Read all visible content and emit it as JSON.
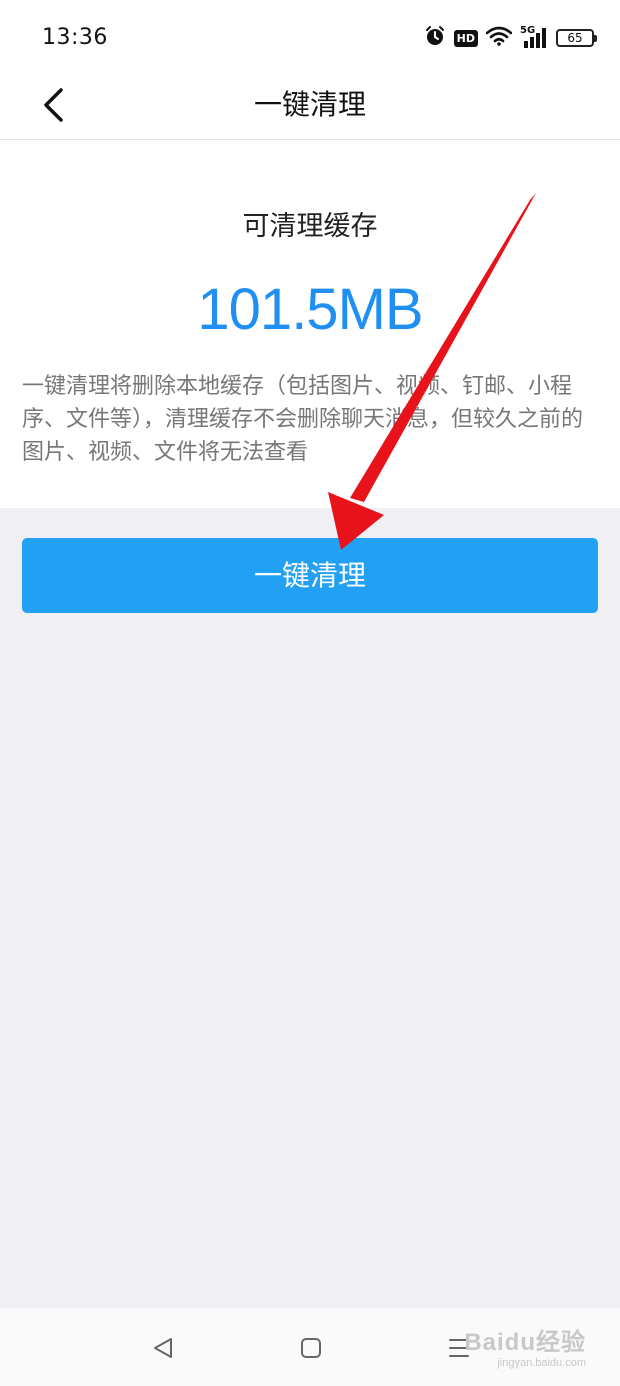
{
  "status_bar": {
    "time": "13:36",
    "hd_label": "HD",
    "network_label": "5G",
    "battery_level": "65",
    "icons": [
      "alarm-icon",
      "hd-icon",
      "wifi-icon",
      "signal-5g-icon",
      "battery-icon"
    ]
  },
  "nav": {
    "title": "一键清理",
    "back_icon": "chevron-left-icon"
  },
  "cache": {
    "label": "可清理缓存",
    "size": "101.5MB",
    "description": "一键清理将删除本地缓存（包括图片、视频、钉邮、小程序、文件等），清理缓存不会删除聊天消息，但较久之前的图片、视频、文件将无法查看"
  },
  "actions": {
    "clean_label": "一键清理"
  },
  "system_nav": {
    "back_icon": "triangle-back-icon",
    "home_icon": "square-home-icon",
    "menu_icon": "menu-lines-icon"
  },
  "watermark": {
    "main": "Baidu经验",
    "sub": "jingyan.baidu.com"
  },
  "colors": {
    "accent": "#22a0f3",
    "size_text": "#1f8ff2",
    "annotation_arrow": "#e8131a",
    "page_background": "#efeff4"
  }
}
